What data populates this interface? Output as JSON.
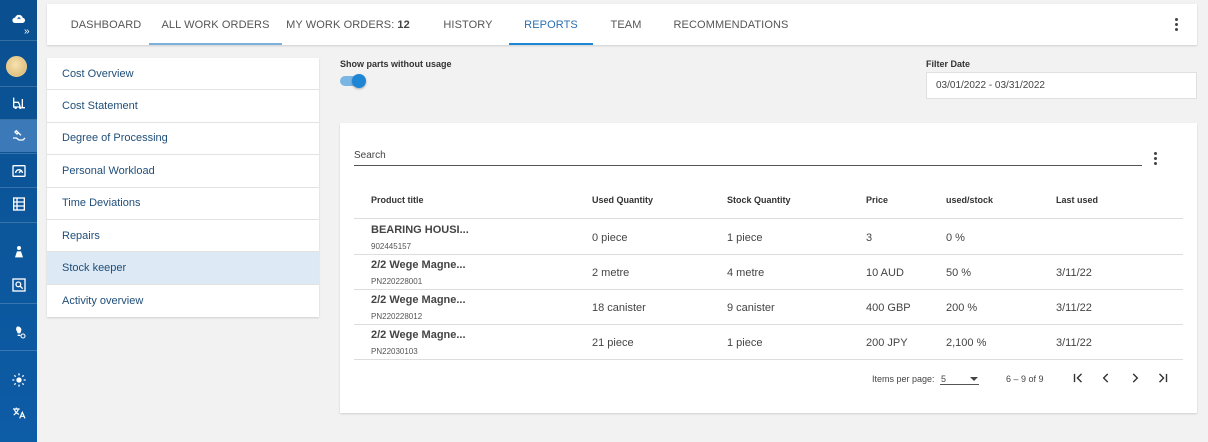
{
  "nav_rail": {
    "icons": [
      "cloud-icon",
      "expand-icon",
      "avatar",
      "forklift-icon",
      "wrench-hand-icon",
      "dashboard-icon",
      "list-icon",
      "person-icon",
      "search-doc-icon",
      "lightbulb-gear-icon",
      "brightness-icon",
      "translate-icon"
    ]
  },
  "tabs": [
    {
      "label": "DASHBOARD"
    },
    {
      "label": "ALL WORK ORDERS"
    },
    {
      "label": "MY WORK ORDERS:",
      "count": "12"
    },
    {
      "label": "HISTORY"
    },
    {
      "label": "REPORTS"
    },
    {
      "label": "TEAM"
    },
    {
      "label": "RECOMMENDATIONS"
    }
  ],
  "report_menu": [
    {
      "label": "Cost Overview"
    },
    {
      "label": "Cost Statement"
    },
    {
      "label": "Degree of Processing"
    },
    {
      "label": "Personal Workload"
    },
    {
      "label": "Time Deviations"
    },
    {
      "label": "Repairs"
    },
    {
      "label": "Stock keeper"
    },
    {
      "label": "Activity overview"
    }
  ],
  "toggle": {
    "label": "Show parts without usage",
    "on": true
  },
  "filter": {
    "label": "Filter Date",
    "value": "03/01/2022 - 03/31/2022"
  },
  "search": {
    "placeholder": "Search"
  },
  "table": {
    "columns": [
      "Product title",
      "Used Quantity",
      "Stock Quantity",
      "Price",
      "used/stock",
      "Last used"
    ],
    "rows": [
      {
        "title": "BEARING HOUSI...",
        "number": "902445157",
        "used": "0 piece",
        "stock": "1 piece",
        "price": "3",
        "ratio": "0 %",
        "last": ""
      },
      {
        "title": "2/2 Wege Magne...",
        "number": "PN220228001",
        "used": "2 metre",
        "stock": "4 metre",
        "price": "10 AUD",
        "ratio": "50 %",
        "last": "3/11/22"
      },
      {
        "title": "2/2 Wege Magne...",
        "number": "PN220228012",
        "used": "18 canister",
        "stock": "9 canister",
        "price": "400 GBP",
        "ratio": "200 %",
        "last": "3/11/22"
      },
      {
        "title": "2/2 Wege Magne...",
        "number": "PN22030103",
        "used": "21 piece",
        "stock": "1 piece",
        "price": "200 JPY",
        "ratio": "2,100 %",
        "last": "3/11/22"
      }
    ]
  },
  "paginator": {
    "items_label": "Items per page:",
    "page_size": "5",
    "range": "6 – 9 of 9"
  },
  "colors": {
    "rail": "#0d5ca6",
    "accent": "#1f86d6",
    "selected_menu": "#dde9f5"
  }
}
